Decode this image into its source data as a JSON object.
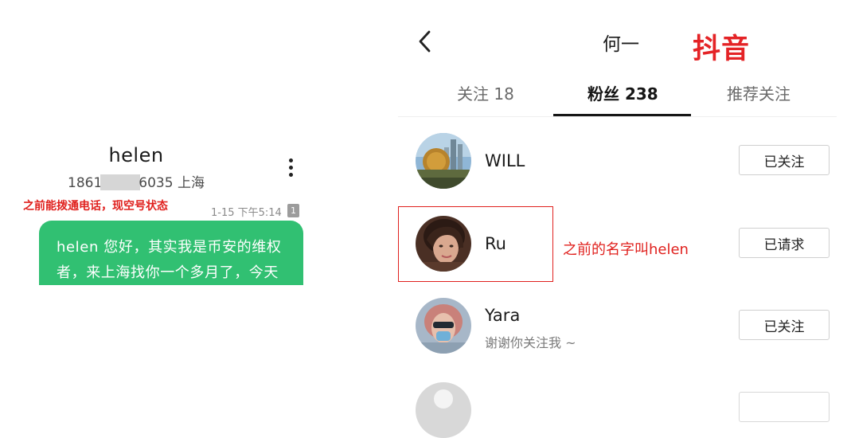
{
  "sms": {
    "contact_name": "helen",
    "phone_prefix": "1861",
    "phone_suffix": "6035",
    "location": "上海",
    "annotation": "之前能拨通电话，现空号状态",
    "timestamp": "1-15 下午5:14",
    "sim_slot": "1",
    "message_line1": "helen 您好，其实我是币安的维权",
    "message_line2": "者，来上海找你一个多月了，今天",
    "bubble_color": "#31c072"
  },
  "douyin": {
    "page_title": "何一",
    "brand_label": "抖音",
    "tabs": [
      {
        "label": "关注 18"
      },
      {
        "label": "粉丝 238"
      },
      {
        "label": "推荐关注"
      }
    ],
    "active_tab": "粉丝 238",
    "annotation": "之前的名字叫helen",
    "users": [
      {
        "name": "WILL",
        "bio": "",
        "button": "已关注",
        "avatar": "building-avatar"
      },
      {
        "name": "Ru",
        "bio": "",
        "button": "已请求",
        "avatar": "woman-portrait-avatar"
      },
      {
        "name": "Yara",
        "bio": "谢谢你关注我 ~",
        "button": "已关注",
        "avatar": "woman-sunglasses-avatar"
      }
    ],
    "accent_color": "#e42326"
  }
}
